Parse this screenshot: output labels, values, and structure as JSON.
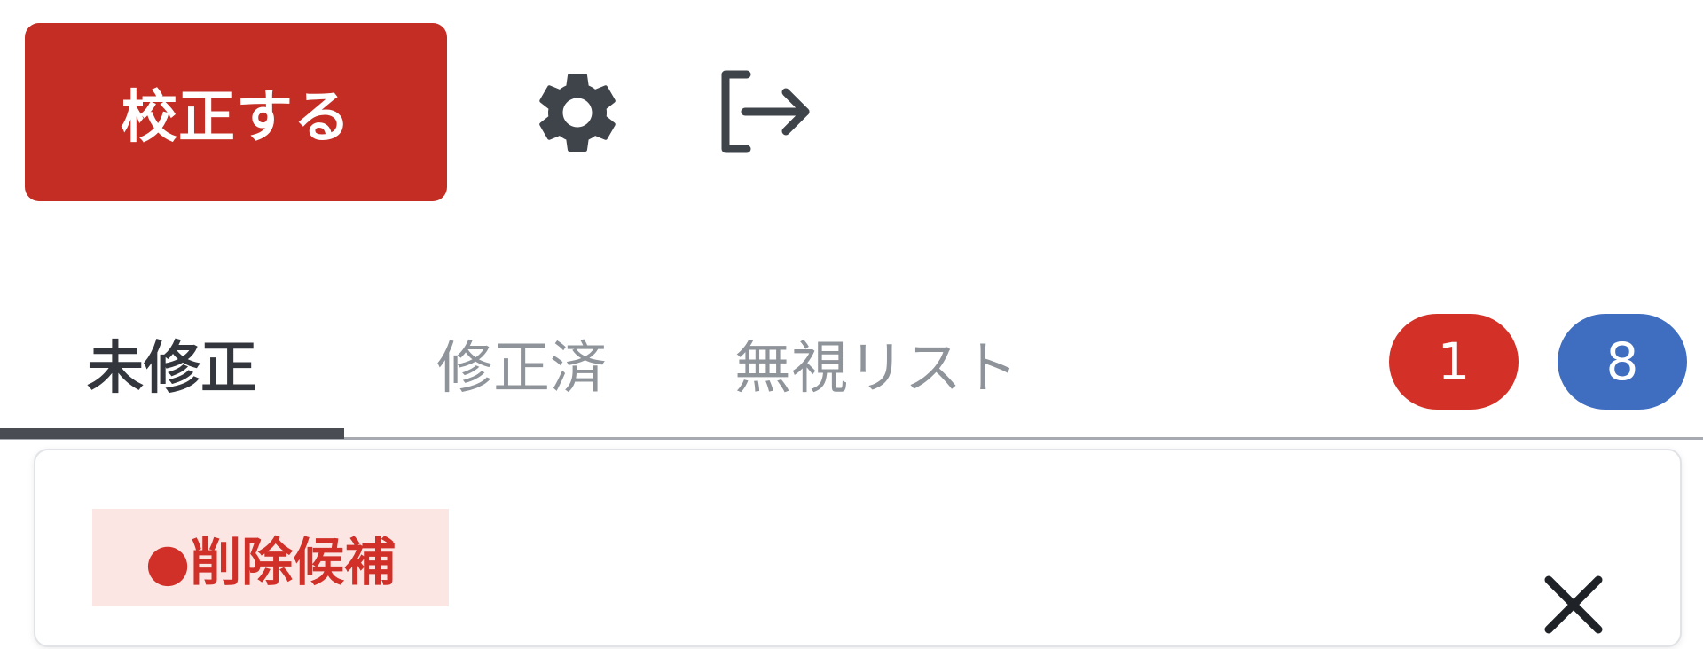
{
  "toolbar": {
    "proofread_label": "校正する",
    "settings_icon": "gear-icon",
    "logout_icon": "logout-arrow-icon"
  },
  "tabs": [
    {
      "label": "未修正",
      "active": true
    },
    {
      "label": "修正済",
      "active": false
    },
    {
      "label": "無視リスト",
      "active": false
    }
  ],
  "badges": {
    "error_count": "1",
    "info_count": "8"
  },
  "results": [
    {
      "category_label": "●削除候補",
      "close_icon": "close-icon"
    }
  ],
  "colors": {
    "primary_button": "#c42d24",
    "error_badge": "#d33127",
    "info_badge": "#3f6dc0",
    "tag_text": "#d03028",
    "tag_background": "#fbe6e4"
  }
}
